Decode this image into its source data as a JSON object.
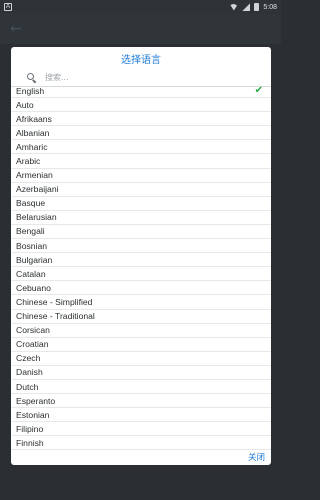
{
  "status_bar": {
    "notification_icon": "notification-icon",
    "time": "5:08",
    "icons": [
      "wifi-icon",
      "signal-icon",
      "battery-icon"
    ]
  },
  "dialog": {
    "title": "选择语言",
    "search": {
      "placeholder": "搜索..."
    },
    "languages": [
      {
        "label": "English",
        "selected": true
      },
      {
        "label": "Auto",
        "selected": false
      },
      {
        "label": "Afrikaans",
        "selected": false
      },
      {
        "label": "Albanian",
        "selected": false
      },
      {
        "label": "Amharic",
        "selected": false
      },
      {
        "label": "Arabic",
        "selected": false
      },
      {
        "label": "Armenian",
        "selected": false
      },
      {
        "label": "Azerbaijani",
        "selected": false
      },
      {
        "label": "Basque",
        "selected": false
      },
      {
        "label": "Belarusian",
        "selected": false
      },
      {
        "label": "Bengali",
        "selected": false
      },
      {
        "label": "Bosnian",
        "selected": false
      },
      {
        "label": "Bulgarian",
        "selected": false
      },
      {
        "label": "Catalan",
        "selected": false
      },
      {
        "label": "Cebuano",
        "selected": false
      },
      {
        "label": "Chinese - Simplified",
        "selected": false
      },
      {
        "label": "Chinese - Traditional",
        "selected": false
      },
      {
        "label": "Corsican",
        "selected": false
      },
      {
        "label": "Croatian",
        "selected": false
      },
      {
        "label": "Czech",
        "selected": false
      },
      {
        "label": "Danish",
        "selected": false
      },
      {
        "label": "Dutch",
        "selected": false
      },
      {
        "label": "Esperanto",
        "selected": false
      },
      {
        "label": "Estonian",
        "selected": false
      },
      {
        "label": "Filipino",
        "selected": false
      },
      {
        "label": "Finnish",
        "selected": false
      }
    ],
    "close_label": "关闭"
  },
  "colors": {
    "accent": "#1e7bd6",
    "check": "#2fa84a"
  }
}
